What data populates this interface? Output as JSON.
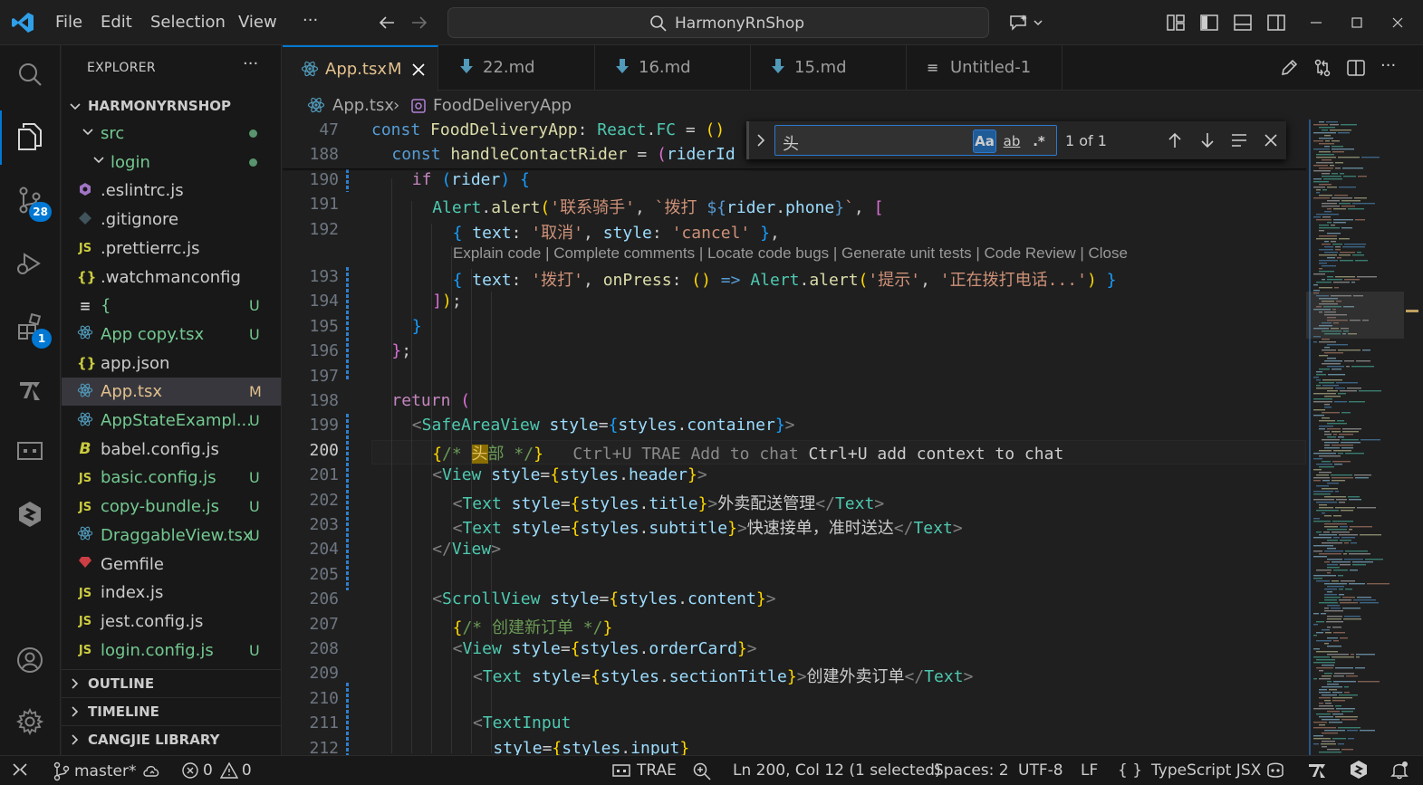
{
  "titlebar": {
    "menu": [
      "File",
      "Edit",
      "Selection",
      "View"
    ],
    "more": "···",
    "search_text": "HarmonyRnShop"
  },
  "activity_bar": {
    "source_control_badge": "28",
    "extensions_badge": "1"
  },
  "sidebar": {
    "title": "EXPLORER",
    "more": "···",
    "root": "HARMONYRNSHOP",
    "items": [
      {
        "label": "src",
        "type": "folder-open",
        "badge": "",
        "dot": true,
        "color": "#73c991",
        "indent": 1
      },
      {
        "label": "login",
        "type": "folder-open",
        "badge": "",
        "dot": true,
        "color": "#73c991",
        "indent": 2
      },
      {
        "label": ".eslintrc.js",
        "type": "eslint",
        "badge": "",
        "color": "#cccccc",
        "indent": 1
      },
      {
        "label": ".gitignore",
        "type": "git",
        "badge": "",
        "color": "#cccccc",
        "indent": 1
      },
      {
        "label": ".prettierrc.js",
        "type": "js",
        "badge": "",
        "color": "#cccccc",
        "indent": 1
      },
      {
        "label": ".watchmanconfig",
        "type": "json",
        "badge": "",
        "color": "#cccccc",
        "indent": 1
      },
      {
        "label": "{",
        "type": "text",
        "badge": "U",
        "color": "#73c991",
        "indent": 1
      },
      {
        "label": "App copy.tsx",
        "type": "react",
        "badge": "U",
        "color": "#73c991",
        "indent": 1
      },
      {
        "label": "app.json",
        "type": "json",
        "badge": "",
        "color": "#cccccc",
        "indent": 1
      },
      {
        "label": "App.tsx",
        "type": "react",
        "badge": "M",
        "color": "#e2c08d",
        "indent": 1,
        "selected": true
      },
      {
        "label": "AppStateExampl...",
        "type": "react",
        "badge": "U",
        "color": "#73c991",
        "indent": 1
      },
      {
        "label": "babel.config.js",
        "type": "babel",
        "badge": "",
        "color": "#cccccc",
        "indent": 1
      },
      {
        "label": "basic.config.js",
        "type": "js",
        "badge": "U",
        "color": "#73c991",
        "indent": 1
      },
      {
        "label": "copy-bundle.js",
        "type": "js",
        "badge": "U",
        "color": "#73c991",
        "indent": 1
      },
      {
        "label": "DraggableView.tsx",
        "type": "react",
        "badge": "U",
        "color": "#73c991",
        "indent": 1
      },
      {
        "label": "Gemfile",
        "type": "ruby",
        "badge": "",
        "color": "#cccccc",
        "indent": 1
      },
      {
        "label": "index.js",
        "type": "js",
        "badge": "",
        "color": "#cccccc",
        "indent": 1
      },
      {
        "label": "jest.config.js",
        "type": "js",
        "badge": "",
        "color": "#cccccc",
        "indent": 1
      },
      {
        "label": "login.config.js",
        "type": "js",
        "badge": "U",
        "color": "#73c991",
        "indent": 1
      }
    ],
    "sections": [
      "OUTLINE",
      "TIMELINE",
      "CANGJIE LIBRARY"
    ]
  },
  "tabs": [
    {
      "label": "App.tsx",
      "status": "M",
      "active": true,
      "icon": "react"
    },
    {
      "label": "22.md",
      "active": false,
      "icon": "markdown"
    },
    {
      "label": "16.md",
      "active": false,
      "icon": "markdown"
    },
    {
      "label": "15.md",
      "active": false,
      "icon": "markdown"
    },
    {
      "label": "Untitled-1",
      "active": false,
      "icon": "text"
    }
  ],
  "breadcrumb": {
    "file": "App.tsx",
    "symbol": "FoodDeliveryApp"
  },
  "find": {
    "query": "头",
    "match_case": "Aa",
    "whole_word": "ab",
    "regex": ".*",
    "count": "1 of 1"
  },
  "codelens": "Explain code | Complete comments | Locate code bugs | Generate unit tests | Code Review | Close",
  "code_lines": [
    {
      "n": "47",
      "html": "<span class='kw'>const</span> <span class='fn'>FoodDeliveryApp</span><span class='tx'>: </span><span class='ty'>React</span><span class='tx'>.</span><span class='ty'>FC</span><span class='tx'> = </span><span class='br'>()</span>",
      "indent": 0
    },
    {
      "n": "188",
      "html": "<span class='kw'>const</span> <span class='fn'>handleContactRider</span><span class='tx'> = </span><span class='br2'>(</span><span class='var'>riderId</span>",
      "indent": 1
    },
    {
      "n": "190",
      "html": "<span class='ctl'>if</span><span class='tx'> </span><span class='br3'>(</span><span class='var'>rider</span><span class='br3'>)</span><span class='tx'> </span><span class='br3'>{</span>",
      "indent": 2
    },
    {
      "n": "191",
      "html": "<span class='ty'>Alert</span><span class='tx'>.</span><span class='fn'>alert</span><span class='br'>(</span><span class='str'>'联系骑手'</span><span class='tx'>, </span><span class='str'>`拨打 </span><span class='kw'>${</span><span class='var'>rider</span><span class='tx'>.</span><span class='var'>phone</span><span class='kw'>}</span><span class='str'>`</span><span class='tx'>, </span><span class='br2'>[</span>",
      "indent": 3
    },
    {
      "n": "192",
      "html": "<span class='br3'>{</span><span class='tx'> </span><span class='var'>text</span><span class='tx'>: </span><span class='str'>'取消'</span><span class='tx'>, </span><span class='var'>style</span><span class='tx'>: </span><span class='str'>'cancel'</span><span class='tx'> </span><span class='br3'>}</span><span class='tx'>,</span>",
      "indent": 4
    },
    {
      "n": "193",
      "html": "<span class='br3'>{</span><span class='tx'> </span><span class='var'>text</span><span class='tx'>: </span><span class='str'>'拨打'</span><span class='tx'>, </span><span class='fn'>onPress</span><span class='tx'>: </span><span class='br'>()</span><span class='tx'> </span><span class='kw'>=&gt;</span><span class='tx'> </span><span class='ty'>Alert</span><span class='tx'>.</span><span class='fn'>alert</span><span class='br'>(</span><span class='str'>'提示'</span><span class='tx'>, </span><span class='str'>'正在拨打电话...'</span><span class='br'>)</span><span class='tx'> </span><span class='br3'>}</span>",
      "indent": 4
    },
    {
      "n": "194",
      "html": "<span class='br2'>]</span><span class='br'>)</span><span class='tx'>;</span>",
      "indent": 3
    },
    {
      "n": "195",
      "html": "<span class='br3'>}</span>",
      "indent": 2
    },
    {
      "n": "196",
      "html": "<span class='br2'>}</span><span class='tx'>;</span>",
      "indent": 1
    },
    {
      "n": "197",
      "html": "",
      "indent": 1
    },
    {
      "n": "198",
      "html": "<span class='ctl'>return</span><span class='tx'> </span><span class='br2'>(</span>",
      "indent": 1
    },
    {
      "n": "199",
      "html": "<span class='pun'>&lt;</span><span class='tag'>SafeAreaView</span><span class='tx'> </span><span class='var'>style</span><span class='tx'>=</span><span class='br3'>{</span><span class='var'>styles</span><span class='tx'>.</span><span class='var'>container</span><span class='br3'>}</span><span class='pun'>&gt;</span>",
      "indent": 2
    },
    {
      "n": "200",
      "html": "<span class='br'>{</span><span class='cm'>/* </span><span class='cm' style='background:#8a6d00;color:#e0c060'>头</span><span class='cm'>部 */</span><span class='br'>}</span>   <span id='ghost'>Ctrl+U TRAE Add to chat <span class='tx'>Ctrl+U add context to chat</span></span>",
      "indent": 3,
      "current": true
    },
    {
      "n": "201",
      "html": "<span class='pun'>&lt;</span><span class='tag'>View</span><span class='tx'> </span><span class='var'>style</span><span class='tx'>=</span><span class='br'>{</span><span class='var'>styles</span><span class='tx'>.</span><span class='var'>header</span><span class='br'>}</span><span class='pun'>&gt;</span>",
      "indent": 3
    },
    {
      "n": "202",
      "html": "<span class='pun'>&lt;</span><span class='tag'>Text</span><span class='tx'> </span><span class='var'>style</span><span class='tx'>=</span><span class='br'>{</span><span class='var'>styles</span><span class='tx'>.</span><span class='var'>title</span><span class='br'>}</span><span class='pun'>&gt;</span><span class='tx'>外卖配送管理</span><span class='pun'>&lt;/</span><span class='tag'>Text</span><span class='pun'>&gt;</span>",
      "indent": 4
    },
    {
      "n": "203",
      "html": "<span class='pun'>&lt;</span><span class='tag'>Text</span><span class='tx'> </span><span class='var'>style</span><span class='tx'>=</span><span class='br'>{</span><span class='var'>styles</span><span class='tx'>.</span><span class='var'>subtitle</span><span class='br'>}</span><span class='pun'>&gt;</span><span class='tx'>快速接单，准时送达</span><span class='pun'>&lt;/</span><span class='tag'>Text</span><span class='pun'>&gt;</span>",
      "indent": 4
    },
    {
      "n": "204",
      "html": "<span class='pun'>&lt;/</span><span class='tag'>View</span><span class='pun'>&gt;</span>",
      "indent": 3
    },
    {
      "n": "205",
      "html": "",
      "indent": 3
    },
    {
      "n": "206",
      "html": "<span class='pun'>&lt;</span><span class='tag'>ScrollView</span><span class='tx'> </span><span class='var'>style</span><span class='tx'>=</span><span class='br'>{</span><span class='var'>styles</span><span class='tx'>.</span><span class='var'>content</span><span class='br'>}</span><span class='pun'>&gt;</span>",
      "indent": 3
    },
    {
      "n": "207",
      "html": "<span class='br'>{</span><span class='cm'>/* 创建新订单 */</span><span class='br'>}</span>",
      "indent": 4
    },
    {
      "n": "208",
      "html": "<span class='pun'>&lt;</span><span class='tag'>View</span><span class='tx'> </span><span class='var'>style</span><span class='tx'>=</span><span class='br'>{</span><span class='var'>styles</span><span class='tx'>.</span><span class='var'>orderCard</span><span class='br'>}</span><span class='pun'>&gt;</span>",
      "indent": 4
    },
    {
      "n": "209",
      "html": "<span class='pun'>&lt;</span><span class='tag'>Text</span><span class='tx'> </span><span class='var'>style</span><span class='tx'>=</span><span class='br'>{</span><span class='var'>styles</span><span class='tx'>.</span><span class='var'>sectionTitle</span><span class='br'>}</span><span class='pun'>&gt;</span><span class='tx'>创建外卖订单</span><span class='pun'>&lt;/</span><span class='tag'>Text</span><span class='pun'>&gt;</span>",
      "indent": 5
    },
    {
      "n": "210",
      "html": "",
      "indent": 5
    },
    {
      "n": "211",
      "html": "<span class='pun'>&lt;</span><span class='tag'>TextInput</span>",
      "indent": 5
    },
    {
      "n": "212",
      "html": "<span class='var'>style</span><span class='tx'>=</span><span class='br'>{</span><span class='var'>styles</span><span class='tx'>.</span><span class='var'>input</span><span class='br'>}</span>",
      "indent": 6
    }
  ],
  "status": {
    "branch": "master*",
    "errors": "0",
    "warnings": "0",
    "trae": "TRAE",
    "position": "Ln 200, Col 12 (1 selected)",
    "spaces": "Spaces: 2",
    "encoding": "UTF-8",
    "eol": "LF",
    "language": "TypeScript JSX"
  }
}
